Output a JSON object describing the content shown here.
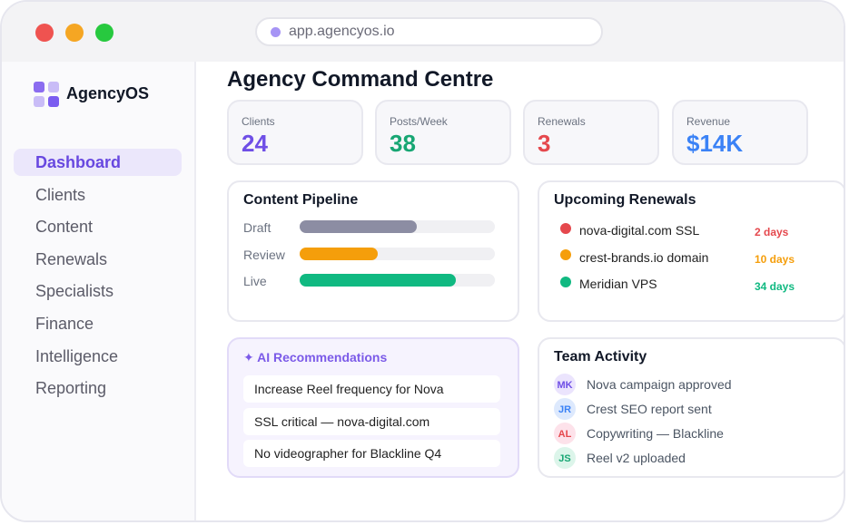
{
  "browser": {
    "url": "app.agencyos.io"
  },
  "sidebar": {
    "brand": "AgencyOS",
    "items": [
      {
        "label": "Dashboard",
        "active": true
      },
      {
        "label": "Clients"
      },
      {
        "label": "Content"
      },
      {
        "label": "Renewals"
      },
      {
        "label": "Specialists"
      },
      {
        "label": "Finance"
      },
      {
        "label": "Intelligence"
      },
      {
        "label": "Reporting"
      }
    ]
  },
  "header": {
    "title": "Agency Command Centre"
  },
  "stats": [
    {
      "label": "Clients",
      "value": "24",
      "color": "#6f4fe6"
    },
    {
      "label": "Posts/Week",
      "value": "38",
      "color": "#17a673"
    },
    {
      "label": "Renewals",
      "value": "3",
      "color": "#e5484d"
    },
    {
      "label": "Revenue",
      "value": "$14K",
      "color": "#3b82f6"
    }
  ],
  "pipeline": {
    "title": "Content Pipeline",
    "rows": [
      {
        "label": "Draft",
        "fraction": 0.6,
        "color": "#8c8da3"
      },
      {
        "label": "Review",
        "fraction": 0.4,
        "color": "#f59e0b"
      },
      {
        "label": "Live",
        "fraction": 0.8,
        "color": "#10b981"
      }
    ]
  },
  "renewals": {
    "title": "Upcoming Renewals",
    "items": [
      {
        "name": "nova-digital.com SSL",
        "days": "2 days",
        "color": "#e5484d"
      },
      {
        "name": "crest-brands.io domain",
        "days": "10 days",
        "color": "#f59e0b"
      },
      {
        "name": "Meridian VPS",
        "days": "34 days",
        "color": "#10b981"
      }
    ]
  },
  "ai": {
    "title": "✦ AI Recommendations",
    "items": [
      "Increase Reel frequency for Nova",
      "SSL critical — nova-digital.com",
      "No videographer for Blackline Q4"
    ]
  },
  "activity": {
    "title": "Team Activity",
    "items": [
      {
        "initials": "MK",
        "text": "Nova campaign approved",
        "bg": "#ebe4fd",
        "fg": "#6f4fe6"
      },
      {
        "initials": "JR",
        "text": "Crest SEO report sent",
        "bg": "#dde9fd",
        "fg": "#3b82f6"
      },
      {
        "initials": "AL",
        "text": "Copywriting — Blackline",
        "bg": "#fde2ea",
        "fg": "#e5484d"
      },
      {
        "initials": "JS",
        "text": "Reel v2 uploaded",
        "bg": "#dcf5ea",
        "fg": "#17a673"
      }
    ]
  }
}
